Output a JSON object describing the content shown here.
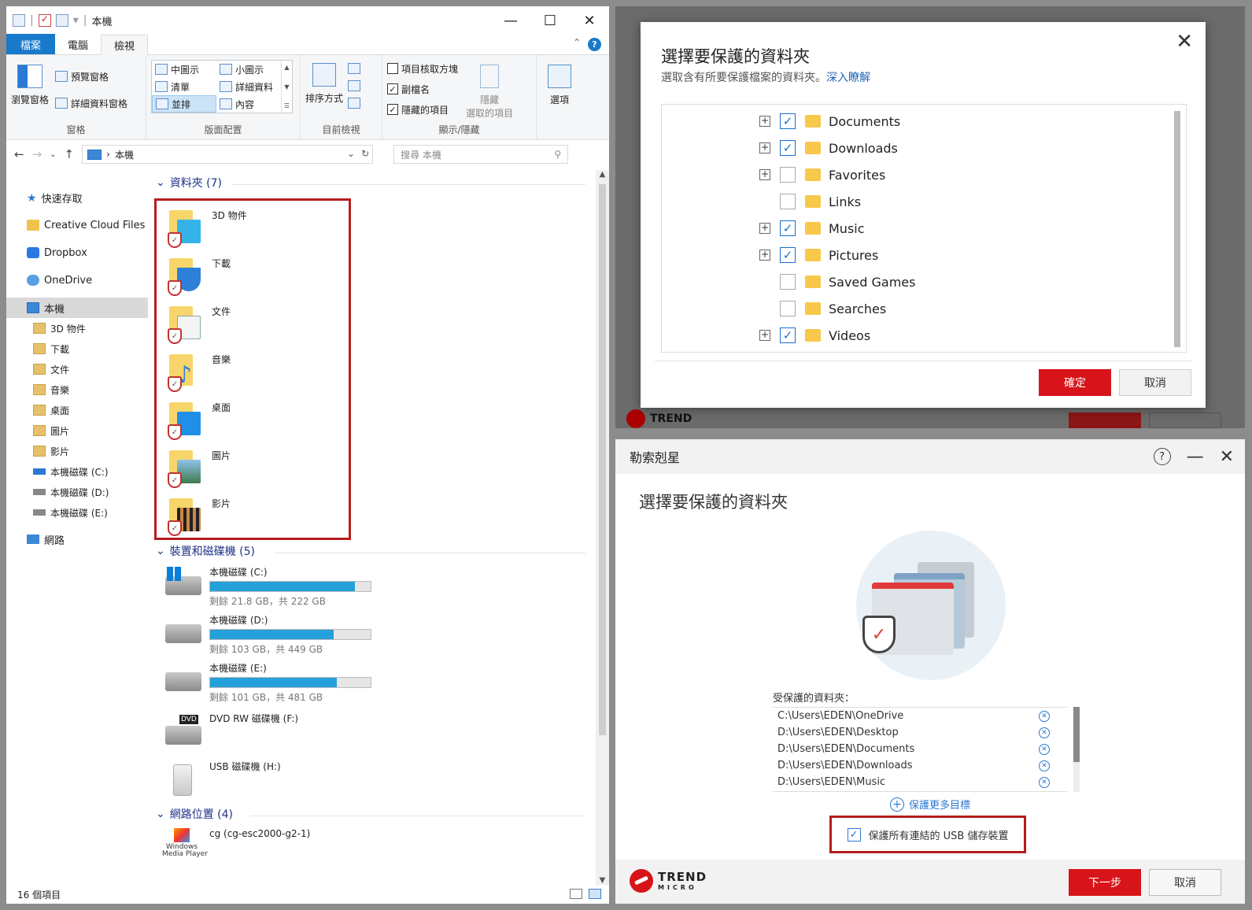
{
  "explorer": {
    "window_title": "本機",
    "win_controls": {
      "minimize": "—",
      "maximize": "☐",
      "close": "✕"
    },
    "tabs": [
      "檔案",
      "電腦",
      "檢視"
    ],
    "help_label": "?",
    "ribbon": {
      "pane_group": {
        "label": "窗格",
        "nav_pane": "瀏覽窗格",
        "preview_pane": "預覽窗格",
        "details_pane": "詳細資料窗格"
      },
      "layout_group": {
        "label": "版面配置",
        "items": [
          "中圖示",
          "小圖示",
          "清單",
          "詳細資料",
          "並排",
          "內容"
        ]
      },
      "current_view_group": {
        "label": "目前檢視",
        "sort_by": "排序方式"
      },
      "show_hide_group": {
        "label": "顯示/隱藏",
        "item_checkboxes": "項目核取方塊",
        "file_extensions": "副檔名",
        "hidden_items": "隱藏的項目",
        "hide_selected": "隱藏\n選取的項目"
      },
      "options": "選項"
    },
    "address": {
      "path": "本機",
      "search_placeholder": "搜尋 本機"
    },
    "nav": {
      "quick_access": "快速存取",
      "creative_cloud": "Creative Cloud Files",
      "dropbox": "Dropbox",
      "onedrive": "OneDrive",
      "this_pc": "本機",
      "sub_items": [
        "3D 物件",
        "下載",
        "文件",
        "音樂",
        "桌面",
        "圖片",
        "影片",
        "本機磁碟 (C:)",
        "本機磁碟 (D:)",
        "本機磁碟 (E:)"
      ],
      "network": "網路"
    },
    "sections": {
      "folders": "資料夾 (7)",
      "devices": "裝置和磁碟機 (5)",
      "network": "網路位置 (4)"
    },
    "folders": [
      "3D 物件",
      "下載",
      "文件",
      "音樂",
      "桌面",
      "圖片",
      "影片"
    ],
    "drives": [
      {
        "name": "本機磁碟 (C:)",
        "info": "剩餘 21.8 GB，共 222 GB",
        "used_fraction": 0.9
      },
      {
        "name": "本機磁碟 (D:)",
        "info": "剩餘 103 GB，共 449 GB",
        "used_fraction": 0.77
      },
      {
        "name": "本機磁碟 (E:)",
        "info": "剩餘 101 GB，共 481 GB",
        "used_fraction": 0.79
      }
    ],
    "other_devices": {
      "dvd": "DVD RW 磁碟機 (F:)",
      "dvd_badge": "DVD",
      "usb": "USB 磁碟機 (H:)"
    },
    "network_location": "cg (cg-esc2000-g2-1)",
    "wmp_label": "Windows\nMedia Player",
    "status": "16 個項目"
  },
  "bg_app": {
    "logo_text": "TREND"
  },
  "folder_dialog": {
    "title": "選擇要保護的資料夾",
    "subtitle": "選取含有所要保護檔案的資料夾。",
    "learn_more": "深入瞭解",
    "close": "✕",
    "tree": [
      {
        "name": "Documents",
        "expandable": true,
        "checked": true
      },
      {
        "name": "Downloads",
        "expandable": true,
        "checked": true
      },
      {
        "name": "Favorites",
        "expandable": true,
        "checked": false
      },
      {
        "name": "Links",
        "expandable": false,
        "checked": false
      },
      {
        "name": "Music",
        "expandable": true,
        "checked": true
      },
      {
        "name": "Pictures",
        "expandable": true,
        "checked": true
      },
      {
        "name": "Saved Games",
        "expandable": false,
        "checked": false
      },
      {
        "name": "Searches",
        "expandable": false,
        "checked": false
      },
      {
        "name": "Videos",
        "expandable": true,
        "checked": true
      }
    ],
    "ok": "確定",
    "cancel": "取消"
  },
  "ransom_app": {
    "title": "勒索剋星",
    "help": "?",
    "minimize": "—",
    "close": "✕",
    "heading": "選擇要保護的資料夾",
    "protected_label": "受保護的資料夾：",
    "protected_folders": [
      "C:\\Users\\EDEN\\OneDrive",
      "D:\\Users\\EDEN\\Desktop",
      "D:\\Users\\EDEN\\Documents",
      "D:\\Users\\EDEN\\Downloads",
      "D:\\Users\\EDEN\\Music"
    ],
    "add_more": "保護更多目標",
    "usb_protect": "保護所有連結的 USB 儲存裝置",
    "usb_checked": true,
    "logo_big": "TREND",
    "logo_small": "MICRO",
    "next": "下一步",
    "cancel": "取消"
  }
}
